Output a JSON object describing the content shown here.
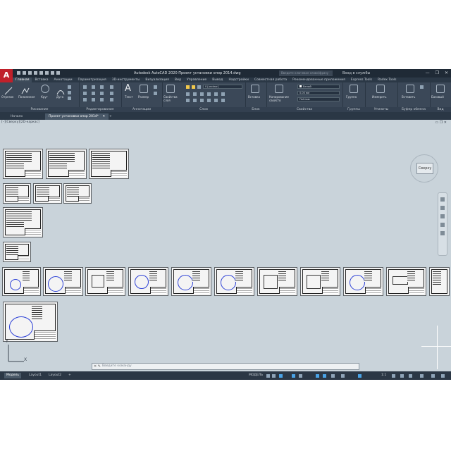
{
  "window": {
    "logo": "A",
    "title": "Autodesk AutoCAD 2020   Проект установки опор 2014.dwg",
    "search_placeholder": "Введите ключевое слово/фразу",
    "user": "Вход в службы",
    "controls": [
      "—",
      "❐",
      "✕"
    ]
  },
  "ribbon_tabs": [
    "Главная",
    "Вставка",
    "Аннотации",
    "Параметризация",
    "3D-инструменты",
    "Визуализация",
    "Вид",
    "Управление",
    "Вывод",
    "Надстройки",
    "Совместная работа",
    "Рекомендованные приложения",
    "Express Tools",
    "Radex Tools"
  ],
  "ribbon": {
    "draw": {
      "label": "Рисование",
      "tools": [
        "Отрезок",
        "Полилиния",
        "Круг",
        "Дуга"
      ]
    },
    "modify": {
      "label": "Редактирование"
    },
    "annotation": {
      "label": "Аннотации",
      "tools": [
        "Текст",
        "Размер"
      ]
    },
    "layers": {
      "label": "Слои",
      "tool": "Свойства слоя",
      "current_layer": "0 [unclear]"
    },
    "block": {
      "label": "Блок",
      "tool": "Вставка"
    },
    "properties": {
      "label": "Свойства",
      "tool": "Копирование свойств",
      "color": "Белый",
      "lineweight": "0.00 мм",
      "linetype": "ПоСлою"
    },
    "groups": {
      "label": "Группы",
      "tool": "Группа"
    },
    "utilities": {
      "label": "Утилиты",
      "tool": "Измерить"
    },
    "clipboard": {
      "label": "Буфер обмена",
      "tool": "Вставить"
    },
    "view": {
      "label": "Вид",
      "tool": "Базовый"
    }
  },
  "doc_tabs": [
    "Начало",
    "Проект установки опор 2014*",
    "+"
  ],
  "viewport": {
    "label": "[–][Сверху][2D-каркас]",
    "controls": "▭ ❐ ✕",
    "viewcube_face": "Сверху",
    "ucs_x": "X",
    "ucs_y": "Y"
  },
  "command_line": {
    "placeholder": "Введите команду",
    "icons": "✕ ✎"
  },
  "status_bar": {
    "layout_tabs": [
      "Модель",
      "Layout1",
      "Layout2",
      "+"
    ],
    "model_label": "МОДЕЛЬ",
    "scale": "1:1"
  },
  "colors": {
    "title_bg": "#1f2a36",
    "ribbon_bg": "#3b4858",
    "canvas_bg": "#c9d3da",
    "logo_red": "#c0202a",
    "drawing_blue": "#2b3fd6"
  }
}
